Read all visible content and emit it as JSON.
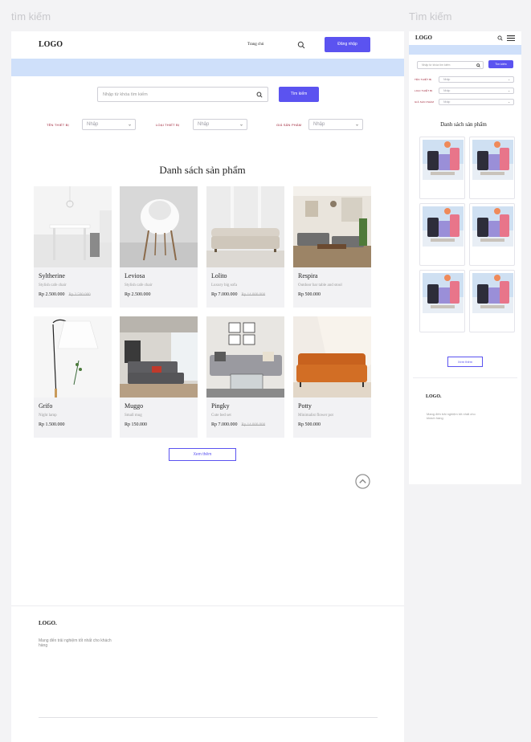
{
  "frames": {
    "desktop_title": "tìm kiếm",
    "mobile_title": "Tìm kiếm"
  },
  "header": {
    "logo": "LOGO",
    "nav_home": "Trang chủ",
    "login_label": "Đăng nhập"
  },
  "search": {
    "placeholder": "Nhập từ khóa tìm kiếm",
    "button_label": "Tìm kiếm"
  },
  "filters": [
    {
      "label": "TÊN THIẾT BỊ",
      "value": "Nhập"
    },
    {
      "label": "LOẠI THIẾT BỊ",
      "value": "Nhập"
    },
    {
      "label": "GIÁ SẢN PHẨM",
      "value": "Nhập"
    }
  ],
  "section_title": "Danh sách sản phẩm",
  "products": [
    {
      "name": "Syltherine",
      "desc": "Stylish cafe chair",
      "price": "Rp 2.500.000",
      "old_price": "Rp 3.500.000"
    },
    {
      "name": "Leviosa",
      "desc": "Stylish cafe chair",
      "price": "Rp 2.500.000",
      "old_price": ""
    },
    {
      "name": "Lolito",
      "desc": "Luxury big sofa",
      "price": "Rp 7.000.000",
      "old_price": "Rp 14.000.000"
    },
    {
      "name": "Respira",
      "desc": "Outdoor bar table and stool",
      "price": "Rp 500.000",
      "old_price": ""
    },
    {
      "name": "Grifo",
      "desc": "Night lamp",
      "price": "Rp 1.500.000",
      "old_price": ""
    },
    {
      "name": "Muggo",
      "desc": "Small mug",
      "price": "Rp 150.000",
      "old_price": ""
    },
    {
      "name": "Pingky",
      "desc": "Cute bed set",
      "price": "Rp 7.000.000",
      "old_price": "Rp 14.000.000"
    },
    {
      "name": "Potty",
      "desc": "Minimalist flower pot",
      "price": "Rp 500.000",
      "old_price": ""
    }
  ],
  "load_more": "Xem thêm",
  "footer": {
    "logo": "LOGO.",
    "tagline": "Mang đến trải nghiệm tốt nhất cho khách hàng"
  },
  "mobile": {
    "logo": "LOGO",
    "search_placeholder": "Nhập từ khóa tìm kiếm",
    "search_button": "Tìm kiếm",
    "filters": [
      {
        "label": "TÊN THIẾT BỊ",
        "value": "Nhập"
      },
      {
        "label": "LOẠI THIẾT BỊ",
        "value": "Nhập"
      },
      {
        "label": "GIÁ SẢN PHẨM",
        "value": "Nhập"
      }
    ],
    "section_title": "Danh sách sản phẩm",
    "load_more": "Xem thêm",
    "footer_logo": "LOGO.",
    "footer_tagline": "Mang đến trải nghiệm tốt nhất cho khách hàng"
  },
  "colors": {
    "accent": "#5b53f0",
    "banner": "#cfe0fa",
    "filter_label": "#9b1b30"
  }
}
